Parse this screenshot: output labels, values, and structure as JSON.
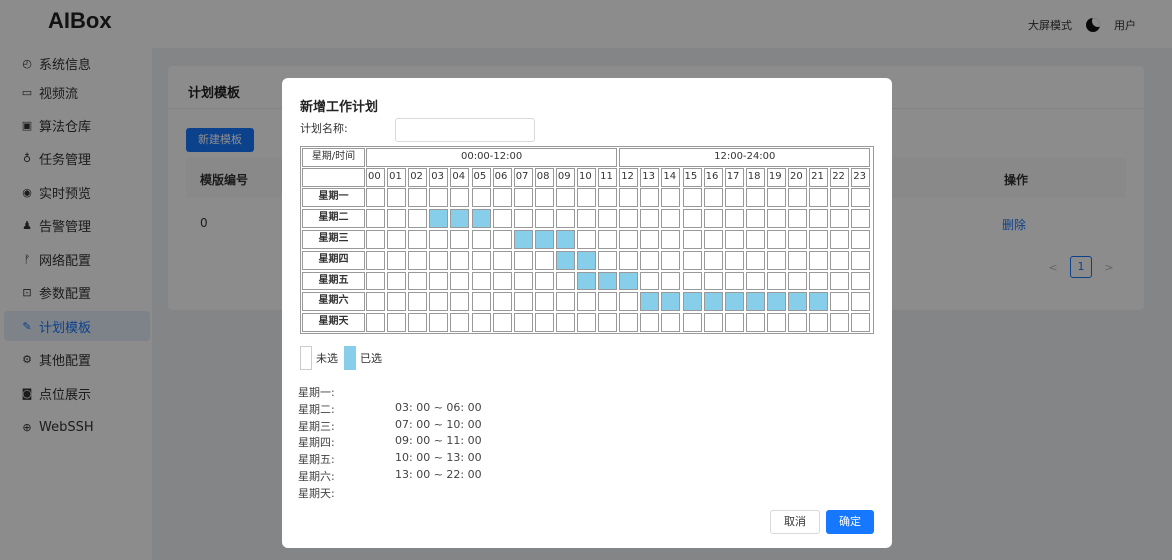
{
  "app": {
    "logo": "AIBox"
  },
  "header": {
    "big_screen_label": "大屏模式",
    "theme_icon": "moon-icon",
    "user_label": "用户"
  },
  "sidebar": {
    "items": [
      {
        "label": "系统信息",
        "icon": "gauge-icon",
        "active": false
      },
      {
        "label": "视频流",
        "icon": "video-icon",
        "active": false
      },
      {
        "label": "算法仓库",
        "icon": "cpu-icon",
        "active": false
      },
      {
        "label": "任务管理",
        "icon": "task-icon",
        "active": false
      },
      {
        "label": "实时预览",
        "icon": "eye-icon",
        "active": false
      },
      {
        "label": "告警管理",
        "icon": "bell-icon",
        "active": false
      },
      {
        "label": "网络配置",
        "icon": "network-icon",
        "active": false
      },
      {
        "label": "参数配置",
        "icon": "settings-icon",
        "active": false
      },
      {
        "label": "计划模板",
        "icon": "edit-icon",
        "active": true
      },
      {
        "label": "其他配置",
        "icon": "gear-icon",
        "active": false
      },
      {
        "label": "点位展示",
        "icon": "camera-icon",
        "active": false
      },
      {
        "label": "WebSSH",
        "icon": "globe-icon",
        "active": false
      }
    ]
  },
  "page": {
    "title": "计划模板",
    "new_button": "新建模板",
    "table": {
      "headers": {
        "id": "模版编号",
        "ops": "操作"
      },
      "rows": [
        {
          "id": "0",
          "delete_label": "删除"
        }
      ]
    },
    "pagination": {
      "current": "1"
    }
  },
  "modal": {
    "title": "新增工作计划",
    "plan_name_label": "计划名称:",
    "plan_name_value": "",
    "grid": {
      "corner": "星期/时间",
      "period_am": "00:00-12:00",
      "period_pm": "12:00-24:00",
      "hours": [
        "00",
        "01",
        "02",
        "03",
        "04",
        "05",
        "06",
        "07",
        "08",
        "09",
        "10",
        "11",
        "12",
        "13",
        "14",
        "15",
        "16",
        "17",
        "18",
        "19",
        "20",
        "21",
        "22",
        "23"
      ],
      "days": [
        "星期一",
        "星期二",
        "星期三",
        "星期四",
        "星期五",
        "星期六",
        "星期天"
      ],
      "selected": [
        [],
        [
          3,
          4,
          5
        ],
        [
          7,
          8,
          9
        ],
        [
          9,
          10
        ],
        [
          10,
          11,
          12
        ],
        [
          13,
          14,
          15,
          16,
          17,
          18,
          19,
          20,
          21
        ],
        []
      ]
    },
    "legend": {
      "unselected": "未选",
      "selected": "已选"
    },
    "summary": [
      {
        "day": "星期一:",
        "time": ""
      },
      {
        "day": "星期二:",
        "time": "03: 00 ~ 06: 00"
      },
      {
        "day": "星期三:",
        "time": "07: 00 ~ 10: 00"
      },
      {
        "day": "星期四:",
        "time": "09: 00 ~ 11: 00"
      },
      {
        "day": "星期五:",
        "time": "10: 00 ~ 13: 00"
      },
      {
        "day": "星期六:",
        "time": "13: 00 ~ 22: 00"
      },
      {
        "day": "星期天:",
        "time": ""
      }
    ],
    "buttons": {
      "cancel": "取消",
      "ok": "确定"
    },
    "colors": {
      "selected": "#87ceeb",
      "primary": "#1677ff"
    }
  }
}
